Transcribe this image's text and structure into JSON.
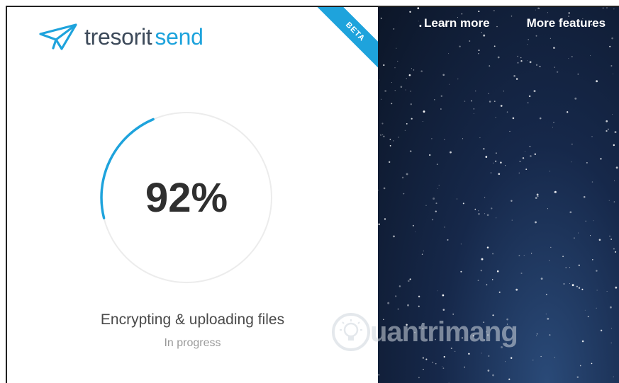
{
  "brand": {
    "name_part1": "tresorit",
    "name_part2": "send",
    "accent": "#1ea3dc"
  },
  "badge": {
    "label": "BETA"
  },
  "progress": {
    "percent_label": "92%",
    "value": 0.92,
    "track_color": "#ececec",
    "fill_color": "#1ea3dc"
  },
  "status": {
    "title": "Encrypting & uploading files",
    "subtitle": "In progress"
  },
  "nav": {
    "items": [
      {
        "label": "Learn more"
      },
      {
        "label": "More features"
      }
    ]
  },
  "watermark": {
    "text": "uantrimang"
  }
}
